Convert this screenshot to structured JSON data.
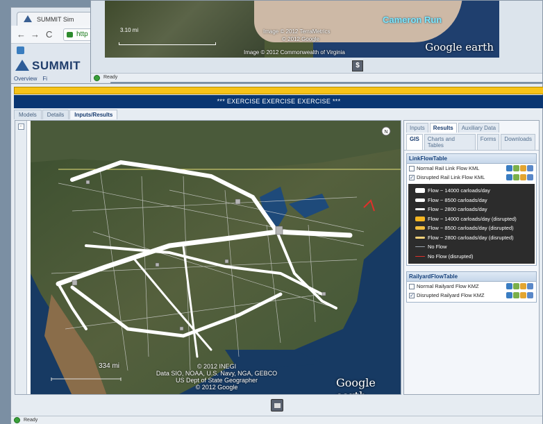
{
  "background_browser": {
    "tab_title": "SUMMIT Sim",
    "back_icon": "back-arrow-icon",
    "forward_icon": "forward-arrow-icon",
    "reload_icon": "reload-icon",
    "url_text": "http",
    "app_logo_text": "SUMMIT",
    "subtabs": [
      "Overview",
      "Fi"
    ]
  },
  "popup": {
    "place_label": "Cameron Run",
    "credit_1": "Image © 2012 TerraMetrics",
    "credit_2": "© 2012 Google",
    "credit_3": "Image © 2012 Commonwealth of Virginia",
    "brand": "Google earth",
    "scale_label": "3.10 mi",
    "status_text": "Ready"
  },
  "main": {
    "banner_text": "*** EXERCISE EXERCISE EXERCISE ***",
    "tabs": [
      "Models",
      "Details",
      "Inputs/Results"
    ],
    "active_tab": "Inputs/Results",
    "map": {
      "north_label": "N",
      "scale_label": "334 mi",
      "credit_lines": [
        "© 2012 INEGI",
        "Data SIO, NOAA, U.S. Navy, NGA, GEBCO",
        "US Dept of State Geographer",
        "© 2012 Google"
      ],
      "brand": "Google earth"
    },
    "status_text": "Ready"
  },
  "panel": {
    "tabs": [
      "Inputs",
      "Results",
      "Auxiliary Data"
    ],
    "active_tab": "Results",
    "subtabs": [
      "GIS",
      "Charts and Tables",
      "Forms",
      "Downloads"
    ],
    "active_subtab": "GIS",
    "link_section": {
      "title": "LinkFlowTable",
      "rows": [
        {
          "label": "Normal Rail Link Flow KML",
          "checked": false
        },
        {
          "label": "Disrupted Rail Link Flow KML",
          "checked": true
        }
      ],
      "legend": [
        {
          "label": "Flow ~ 14000 carloads/day",
          "color": "#ffffff",
          "thickness": 7
        },
        {
          "label": "Flow ~ 8500 carloads/day",
          "color": "#ffffff",
          "thickness": 5
        },
        {
          "label": "Flow ~ 2800 carloads/day",
          "color": "#ffffff",
          "thickness": 3
        },
        {
          "label": "Flow ~ 14000 carloads/day (disrupted)",
          "color": "#f5b622",
          "thickness": 7
        },
        {
          "label": "Flow ~ 8500 carloads/day (disrupted)",
          "color": "#f5c040",
          "thickness": 5
        },
        {
          "label": "Flow ~ 2800 carloads/day (disrupted)",
          "color": "#f7d27a",
          "thickness": 3
        },
        {
          "label": "No Flow",
          "color": "#9aa3ad",
          "thickness": 1
        },
        {
          "label": "No Flow (disrupted)",
          "color": "#e0302a",
          "thickness": 1
        }
      ]
    },
    "railyard_section": {
      "title": "RailyardFlowTable",
      "rows": [
        {
          "label": "Normal Railyard Flow KMZ",
          "checked": false
        },
        {
          "label": "Disrupted Railyard Flow KMZ",
          "checked": true
        }
      ]
    },
    "colors": {
      "panel_head": "#15407a",
      "banner": "#0a3672",
      "alert": "#f7c318"
    }
  }
}
